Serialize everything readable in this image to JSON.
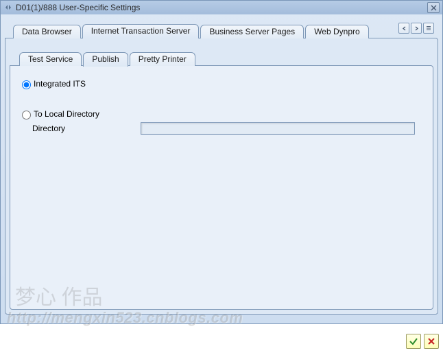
{
  "window": {
    "title": "D01(1)/888 User-Specific Settings"
  },
  "main_tabs": {
    "t0": "Data Browser",
    "t1": "Internet Transaction Server",
    "t2": "Business Server Pages",
    "t3": "Web Dynpro"
  },
  "sub_tabs": {
    "s0": "Test Service",
    "s1": "Publish",
    "s2": "Pretty Printer"
  },
  "options": {
    "integrated_its": "Integrated ITS",
    "to_local_dir": "To Local Directory",
    "directory_label": "Directory",
    "directory_value": ""
  },
  "watermark": {
    "text": "http://mengxin523.cnblogs.com",
    "badge": "梦心 作品"
  }
}
